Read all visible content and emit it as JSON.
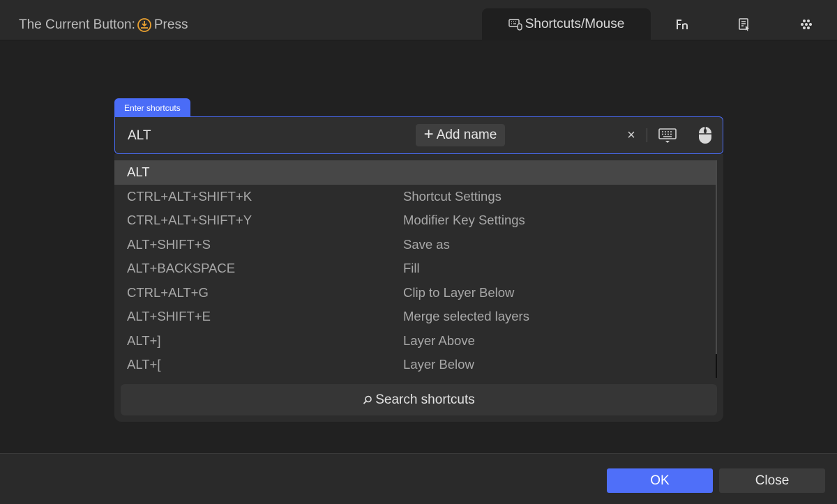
{
  "header": {
    "current_label": "The Current Button:",
    "current_action": "Press",
    "tabs": [
      {
        "label": "Shortcuts/Mouse",
        "icon": "keyboard-mouse-icon",
        "active": true
      },
      {
        "label": "Fn",
        "icon": "fn-icon",
        "active": false
      },
      {
        "label": "",
        "icon": "app-launch-icon",
        "active": false
      },
      {
        "label": "",
        "icon": "dots-grid-icon",
        "active": false
      }
    ]
  },
  "editor": {
    "field_label": "Enter shortcuts",
    "value": "ALT",
    "add_name_label": "Add name",
    "clear_symbol": "×"
  },
  "suggestions": [
    {
      "keys": "ALT",
      "name": "",
      "selected": true
    },
    {
      "keys": "CTRL+ALT+SHIFT+K",
      "name": "Shortcut Settings"
    },
    {
      "keys": "CTRL+ALT+SHIFT+Y",
      "name": "Modifier Key Settings"
    },
    {
      "keys": "ALT+SHIFT+S",
      "name": "Save as"
    },
    {
      "keys": "ALT+BACKSPACE",
      "name": "Fill"
    },
    {
      "keys": "CTRL+ALT+G",
      "name": "Clip to Layer Below"
    },
    {
      "keys": "ALT+SHIFT+E",
      "name": "Merge selected layers"
    },
    {
      "keys": "ALT+]",
      "name": "Layer Above"
    },
    {
      "keys": "ALT+[",
      "name": "Layer Below"
    }
  ],
  "search_label": "Search shortcuts",
  "footer": {
    "ok_label": "OK",
    "close_label": "Close"
  },
  "colors": {
    "accent": "#4f6ff9",
    "background": "#212121",
    "panel": "#2c2c2c",
    "icon_orange": "#e8a030"
  }
}
